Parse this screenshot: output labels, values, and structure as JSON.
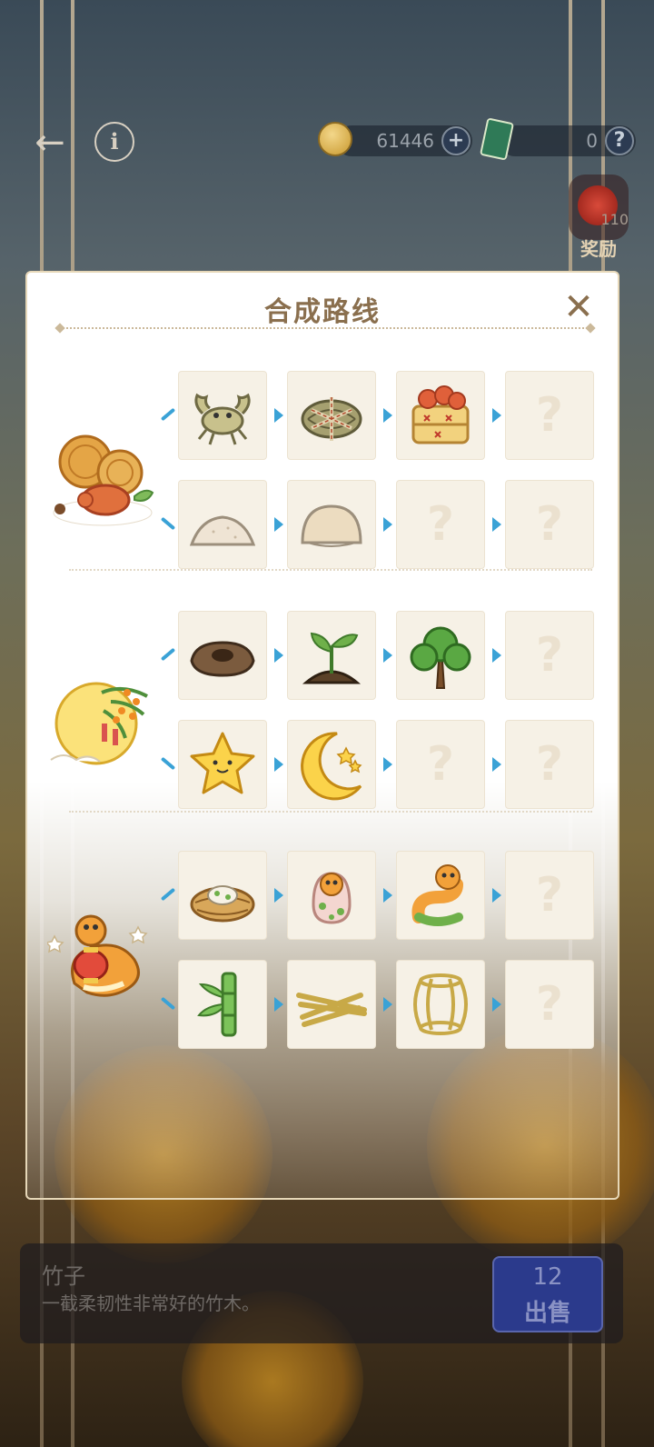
{
  "topbar": {
    "coins": "61446",
    "tickets": "0",
    "reward_count": "110",
    "reward_label": "奖励"
  },
  "panel": {
    "title": "合成路线",
    "close_symbol": "✕",
    "unknown_symbol": "?"
  },
  "groups": [
    {
      "source": "mooncake-crab-icon",
      "chains": [
        [
          "crab-icon",
          "bundled-crab-icon",
          "crab-steamer-icon",
          "unknown"
        ],
        [
          "flour-pile-icon",
          "dough-ball-icon",
          "unknown",
          "unknown"
        ]
      ]
    },
    {
      "source": "osmanthus-moon-icon",
      "chains": [
        [
          "dirt-hole-icon",
          "sprout-icon",
          "tree-icon",
          "unknown"
        ],
        [
          "star-icon",
          "crescent-moon-icon",
          "unknown",
          "unknown"
        ]
      ]
    },
    {
      "source": "snake-lantern-icon",
      "chains": [
        [
          "nest-egg-icon",
          "hatching-snake-icon",
          "snake-icon",
          "unknown"
        ],
        [
          "bamboo-icon",
          "bamboo-strips-icon",
          "bamboo-lantern-frame-icon",
          "unknown"
        ]
      ]
    }
  ],
  "selected_item": {
    "name": "竹子",
    "description": "一截柔韧性非常好的竹木。",
    "price": "12",
    "sell_label": "出售"
  },
  "colors": {
    "accent_blue": "#3aa2d6",
    "title_brown": "#8a6f4e",
    "slot_bg": "#f6f1e6",
    "sell_button": "#2b3a8c"
  }
}
